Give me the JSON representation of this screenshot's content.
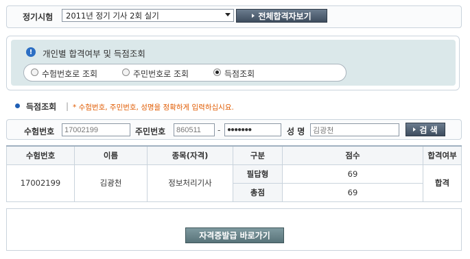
{
  "exam_bar": {
    "label": "정기시험",
    "selected_exam": "2011년 정기 기사 2회 실기",
    "view_all_button": "전체합격자보기"
  },
  "inquiry_options": {
    "title": "개인별 합격여부 및 득점조회",
    "options": [
      {
        "label": "수험번호로 조회",
        "selected": false
      },
      {
        "label": "주민번호로 조회",
        "selected": false
      },
      {
        "label": "득점조회",
        "selected": true
      }
    ]
  },
  "section": {
    "title": "득점조회",
    "separator": "|",
    "note": "* 수험번호, 주민번호, 성명을 정확하게 입력하십시요."
  },
  "search": {
    "exam_number_label": "수험번호",
    "exam_number_value": "17002199",
    "resident_number_label": "주민번호",
    "resident_number_front": "860511",
    "dash": "-",
    "resident_number_back": "●●●●●●●",
    "name_label": "성 명",
    "name_value": "김광천",
    "search_button": "검 색"
  },
  "results_table": {
    "headers": [
      "수험번호",
      "이름",
      "종목(자격)",
      "구분",
      "점수",
      "합격여부"
    ],
    "row": {
      "exam_number": "17002199",
      "name": "김광천",
      "certificate": "정보처리기사",
      "result": "합격"
    },
    "sub_rows": [
      {
        "category": "필답형",
        "score": "69"
      },
      {
        "category": "총점",
        "score": "69"
      }
    ]
  },
  "certificate_button": "자격증발급 바로가기"
}
